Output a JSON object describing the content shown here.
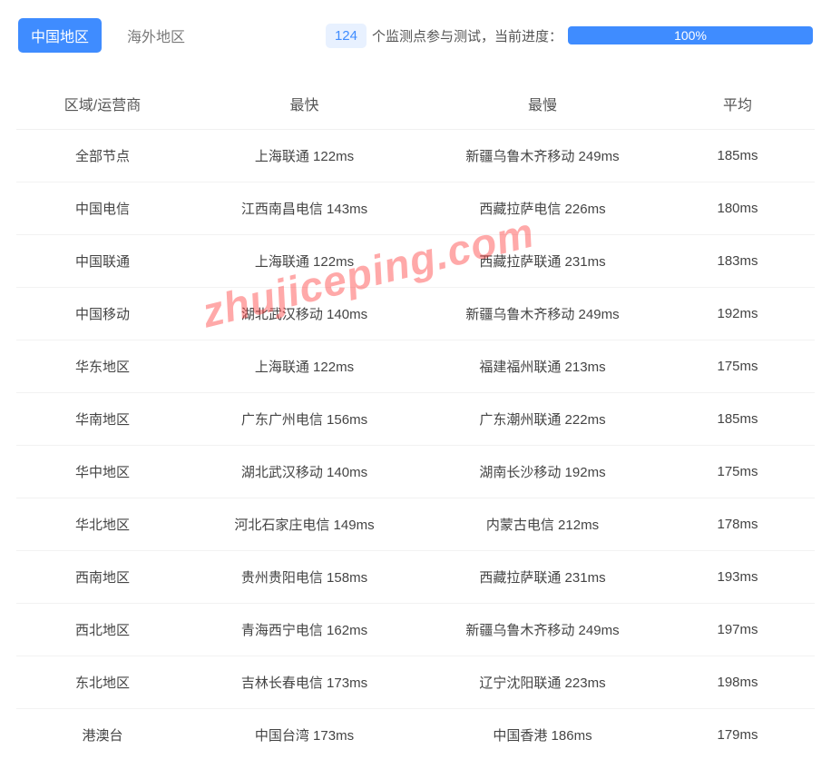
{
  "tabs": {
    "china": "中国地区",
    "overseas": "海外地区"
  },
  "progress": {
    "count": "124",
    "text": "个监测点参与测试，当前进度：",
    "percent": "100%"
  },
  "headers": {
    "region": "区域/运营商",
    "fastest": "最快",
    "slowest": "最慢",
    "average": "平均"
  },
  "watermark": "zhujiceping.com",
  "rows": [
    {
      "region": "全部节点",
      "fastest": "上海联通 122ms",
      "slowest": "新疆乌鲁木齐移动 249ms",
      "average": "185ms"
    },
    {
      "region": "中国电信",
      "fastest": "江西南昌电信 143ms",
      "slowest": "西藏拉萨电信 226ms",
      "average": "180ms"
    },
    {
      "region": "中国联通",
      "fastest": "上海联通 122ms",
      "slowest": "西藏拉萨联通 231ms",
      "average": "183ms"
    },
    {
      "region": "中国移动",
      "fastest": "湖北武汉移动 140ms",
      "slowest": "新疆乌鲁木齐移动 249ms",
      "average": "192ms"
    },
    {
      "region": "华东地区",
      "fastest": "上海联通 122ms",
      "slowest": "福建福州联通 213ms",
      "average": "175ms"
    },
    {
      "region": "华南地区",
      "fastest": "广东广州电信 156ms",
      "slowest": "广东潮州联通 222ms",
      "average": "185ms"
    },
    {
      "region": "华中地区",
      "fastest": "湖北武汉移动 140ms",
      "slowest": "湖南长沙移动 192ms",
      "average": "175ms"
    },
    {
      "region": "华北地区",
      "fastest": "河北石家庄电信 149ms",
      "slowest": "内蒙古电信 212ms",
      "average": "178ms"
    },
    {
      "region": "西南地区",
      "fastest": "贵州贵阳电信 158ms",
      "slowest": "西藏拉萨联通 231ms",
      "average": "193ms"
    },
    {
      "region": "西北地区",
      "fastest": "青海西宁电信 162ms",
      "slowest": "新疆乌鲁木齐移动 249ms",
      "average": "197ms"
    },
    {
      "region": "东北地区",
      "fastest": "吉林长春电信 173ms",
      "slowest": "辽宁沈阳联通 223ms",
      "average": "198ms"
    },
    {
      "region": "港澳台",
      "fastest": "中国台湾 173ms",
      "slowest": "中国香港 186ms",
      "average": "179ms"
    }
  ]
}
